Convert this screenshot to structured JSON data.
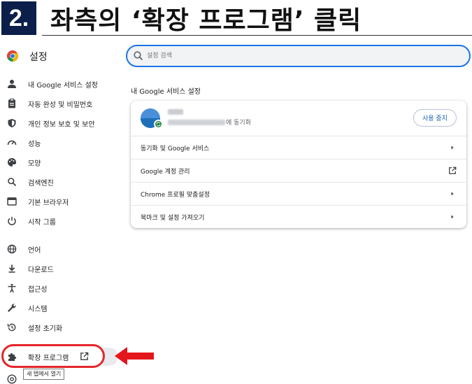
{
  "banner": {
    "step_number": "2.",
    "instruction": "좌측의 ‘확장 프로그램’ 클릭"
  },
  "app": {
    "title": "설정",
    "logo_icon": "chrome-logo-icon"
  },
  "search": {
    "placeholder": "설정 검색",
    "icon": "search-icon"
  },
  "sidebar": {
    "items": [
      {
        "label": "내 Google 서비스 설정",
        "icon": "person-icon"
      },
      {
        "label": "자동 완성 및 비밀번호",
        "icon": "clipboard-icon"
      },
      {
        "label": "개인 정보 보호 및 보안",
        "icon": "shield-icon"
      },
      {
        "label": "성능",
        "icon": "speedometer-icon"
      },
      {
        "label": "모양",
        "icon": "palette-icon"
      },
      {
        "label": "검색엔진",
        "icon": "search-icon"
      },
      {
        "label": "기본 브라우저",
        "icon": "browser-icon"
      },
      {
        "label": "시작 그룹",
        "icon": "power-icon"
      },
      {
        "label": "언어",
        "icon": "globe-icon"
      },
      {
        "label": "다운로드",
        "icon": "download-icon"
      },
      {
        "label": "접근성",
        "icon": "accessibility-icon"
      },
      {
        "label": "시스템",
        "icon": "wrench-icon"
      },
      {
        "label": "설정 초기화",
        "icon": "history-icon"
      },
      {
        "label": "확장 프로그램",
        "icon": "puzzle-icon",
        "trailing_icon": "external-link-icon"
      }
    ],
    "tooltip": "새 탭에서 열기"
  },
  "main": {
    "section_title": "내 Google 서비스 설정",
    "account": {
      "sync_status": "에 동기화",
      "stop_sync_label": "사용 중지"
    },
    "rows": [
      {
        "label": "동기화 및 Google 서비스",
        "trailing": "chevron-right-icon"
      },
      {
        "label": "Google 계정 관리",
        "trailing": "external-link-icon"
      },
      {
        "label": "Chrome 프로필 맞춤설정",
        "trailing": "chevron-right-icon"
      },
      {
        "label": "북마크 및 설정 가져오기",
        "trailing": "chevron-right-icon"
      }
    ]
  },
  "colors": {
    "accent": "#1a73e8",
    "highlight": "#e5262b",
    "banner_bg": "#0b1f4a"
  }
}
